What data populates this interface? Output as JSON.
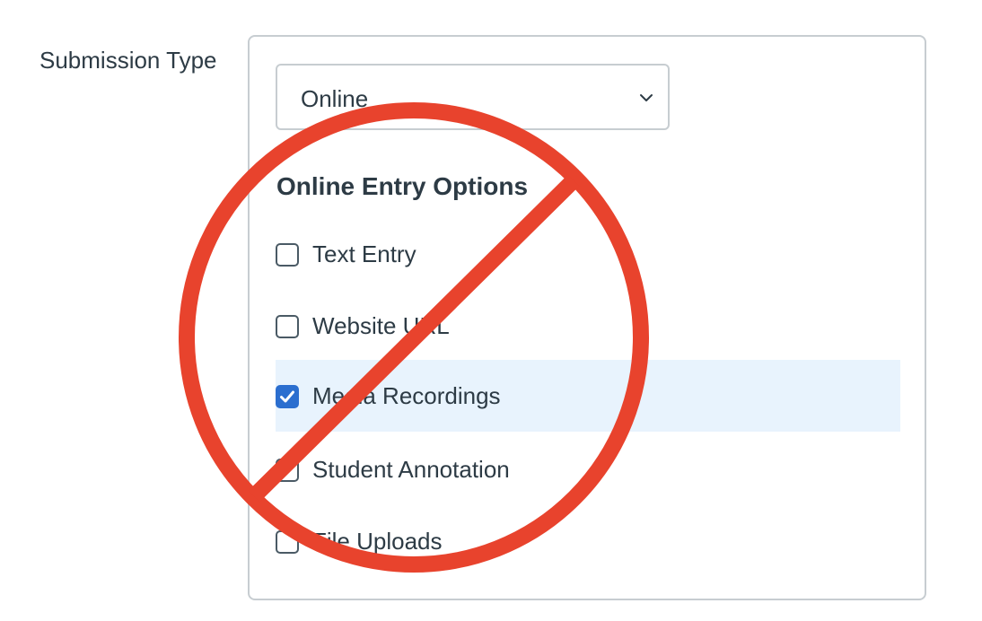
{
  "field_label": "Submission Type",
  "select": {
    "value": "Online",
    "icon": "chevron-down-icon"
  },
  "online_entry": {
    "heading": "Online Entry Options",
    "options": [
      {
        "label": "Text Entry",
        "checked": false
      },
      {
        "label": "Website URL",
        "checked": false
      },
      {
        "label": "Media Recordings",
        "checked": true
      },
      {
        "label": "Student Annotation",
        "checked": false
      },
      {
        "label": "File Uploads",
        "checked": false
      }
    ]
  },
  "overlay": {
    "icon": "prohibition-icon",
    "color": "#e8432d"
  },
  "colors": {
    "highlight": "#e8f3fd",
    "checkbox_checked": "#2b6ecf",
    "border": "#c7cdd1",
    "text": "#2d3b45"
  }
}
